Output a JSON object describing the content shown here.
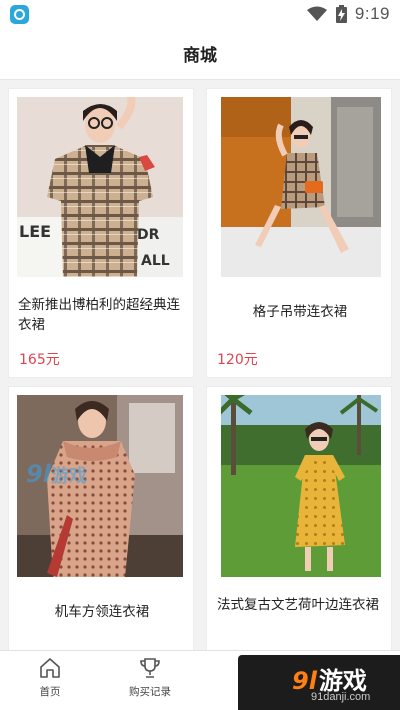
{
  "status_bar": {
    "time": "9:19"
  },
  "header": {
    "title": "商城"
  },
  "products": [
    {
      "title": "全新推出博柏利的超经典连衣裙",
      "price": "165元"
    },
    {
      "title": "格子吊带连衣裙",
      "price": "120元"
    },
    {
      "title": "机车方领连衣裙"
    },
    {
      "title": "法式复古文艺荷叶边连衣裙"
    }
  ],
  "watermark": {
    "number": "9l",
    "text": "游戏"
  },
  "tabbar": {
    "tabs": [
      {
        "label": "首页",
        "icon": "home-icon"
      },
      {
        "label": "购买记录",
        "icon": "trophy-icon"
      },
      {
        "label": "",
        "icon": "shop-icon"
      },
      {
        "label": "",
        "icon": "profile-icon"
      }
    ]
  },
  "overlay": {
    "number": "9l",
    "text": "游戏",
    "site": "91danji.com"
  },
  "colors": {
    "price": "#e0454f",
    "accent_orange": "#ff7f11",
    "badge_blue": "#2aa8dc"
  }
}
